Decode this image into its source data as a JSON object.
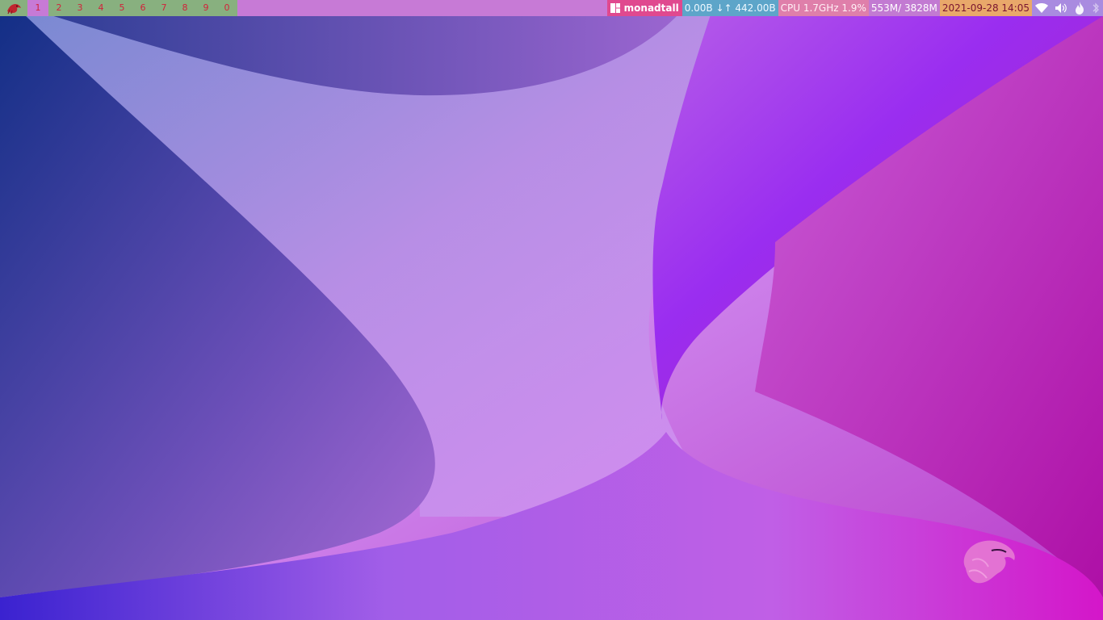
{
  "bar": {
    "groups": [
      {
        "label": "1",
        "active": true
      },
      {
        "label": "2",
        "active": false
      },
      {
        "label": "3",
        "active": false
      },
      {
        "label": "4",
        "active": false
      },
      {
        "label": "5",
        "active": false
      },
      {
        "label": "6",
        "active": false
      },
      {
        "label": "7",
        "active": false
      },
      {
        "label": "8",
        "active": false
      },
      {
        "label": "9",
        "active": false
      },
      {
        "label": "0",
        "active": false
      }
    ],
    "layout_name": "monadtall",
    "net": "0.00B ↓↑ 442.00B",
    "cpu": "CPU 1.7GHz 1.9%",
    "memory": "553M/ 3828M",
    "clock": "2021-09-28 14:05",
    "tray_icons": [
      "wifi-icon",
      "volume-icon",
      "flame-icon",
      "bluetooth-icon"
    ]
  },
  "colors": {
    "bar_bg": "#c77ad6",
    "groupbox_bg": "#88b07f",
    "group_text": "#d2223a",
    "layout_bg": "#e0498f",
    "net_bg": "#5da5c9",
    "cpu_bg": "#df7faa",
    "mem_bg": "#c27ad2",
    "clock_bg": "#e9a86a",
    "tray_bg": "#a98be0"
  }
}
